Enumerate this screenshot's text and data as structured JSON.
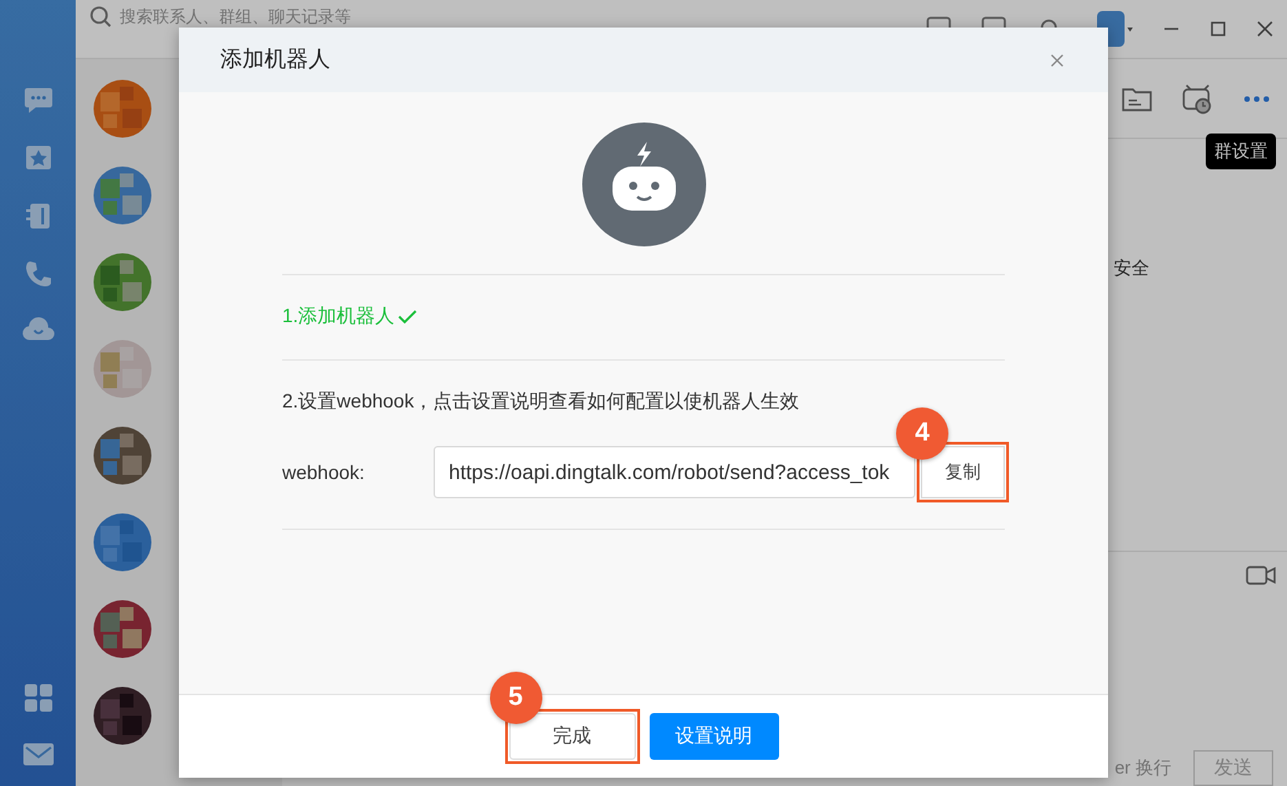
{
  "app": {
    "search": {
      "placeholder": "搜索联系人、群组、聊天记录等"
    },
    "chat": {
      "tooltip": "群设置",
      "message_fragment": "安全",
      "input_hint": "er 换行",
      "send_button": "发送"
    }
  },
  "dialog": {
    "title": "添加机器人",
    "steps": [
      {
        "text": "1.添加机器人",
        "done": true
      },
      {
        "text": "2.设置webhook，点击设置说明查看如何配置以使机器人生效",
        "done": false
      }
    ],
    "webhook": {
      "label": "webhook:",
      "value": "https://oapi.dingtalk.com/robot/send?access_tok",
      "copy_button": "复制",
      "callout": "4"
    },
    "buttons": [
      {
        "label": "完成",
        "kind": "default",
        "callout": "5"
      },
      {
        "label": "设置说明",
        "kind": "primary"
      }
    ]
  }
}
